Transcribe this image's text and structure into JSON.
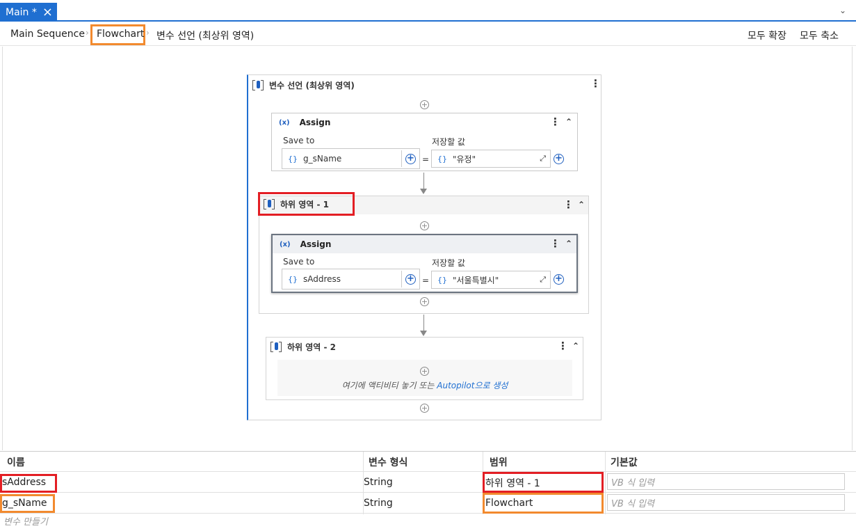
{
  "tabs": [
    {
      "label": "Main *"
    }
  ],
  "breadcrumb": {
    "items": [
      "Main Sequence",
      "Flowchart",
      "변수 선언 (최상위 영역)"
    ]
  },
  "toolbar": {
    "expand_all": "모두 확장",
    "collapse_all": "모두 축소"
  },
  "designer": {
    "outer": {
      "title": "변수 선언 (최상위 영역)"
    },
    "assign1": {
      "title": "Assign",
      "save_to_label": "Save to",
      "value_label": "저장할 값",
      "save_to": "g_sName",
      "value": "\"유정\"",
      "eq": "="
    },
    "scope1": {
      "title": "하위 영역 - 1"
    },
    "assign2": {
      "title": "Assign",
      "save_to_label": "Save to",
      "value_label": "저장할 값",
      "save_to": "sAddress",
      "value": "\"서울특별시\"",
      "eq": "="
    },
    "scope2": {
      "title": "하위 영역 - 2",
      "drop_hint_pre": "여기에 액티비티 놓기 또는 ",
      "drop_hint_link": "Autopilot으로 생성"
    }
  },
  "variables": {
    "headers": [
      "이름",
      "변수 형식",
      "범위",
      "기본값"
    ],
    "rows": [
      {
        "name": "sAddress",
        "type": "String",
        "scope": "하위 영역 - 1",
        "default_placeholder": "VB 식 입력"
      },
      {
        "name": "g_sName",
        "type": "String",
        "scope": "Flowchart",
        "default_placeholder": "VB 식 입력"
      }
    ],
    "create": "변수 만들기"
  },
  "colors": {
    "accent": "#1f6fd1",
    "highlight_orange": "#f28a2e",
    "highlight_red": "#e31e24"
  }
}
